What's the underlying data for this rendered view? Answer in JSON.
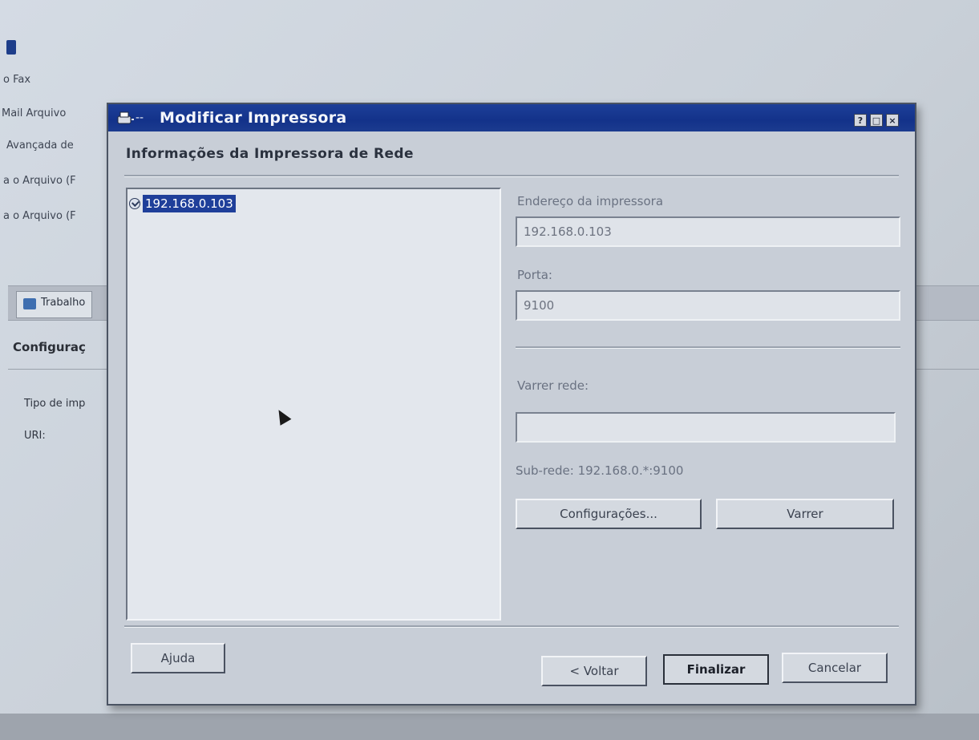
{
  "background": {
    "items": [
      "o Fax",
      "Mail Arquivo",
      "Avançada de",
      "a o Arquivo (F",
      "a o Arquivo (F"
    ],
    "tab_label": "Trabalho",
    "section_title": "Configuraç",
    "fields": [
      "Tipo de imp",
      "URI:"
    ]
  },
  "dialog": {
    "title": "Modificar Impressora",
    "title_buttons": [
      "?",
      "□",
      "×"
    ],
    "header": "Informações da Impressora de Rede",
    "list_items": [
      "192.168.0.103"
    ],
    "address_label": "Endereço da impressora",
    "address_value": "192.168.0.103",
    "port_label": "Porta:",
    "port_value": "9100",
    "scan_label": "Varrer rede:",
    "scan_value": "",
    "subnet_text": "Sub-rede: 192.168.0.*:9100",
    "config_button": "Configurações...",
    "scan_button": "Varrer",
    "help_button": "Ajuda",
    "back_button": "< Voltar",
    "finish_button": "Finalizar",
    "cancel_button": "Cancelar"
  },
  "colors": {
    "titlebar": "#1d3f98",
    "dialog_bg": "#c8ced7",
    "selection": "#1f3f9a"
  }
}
